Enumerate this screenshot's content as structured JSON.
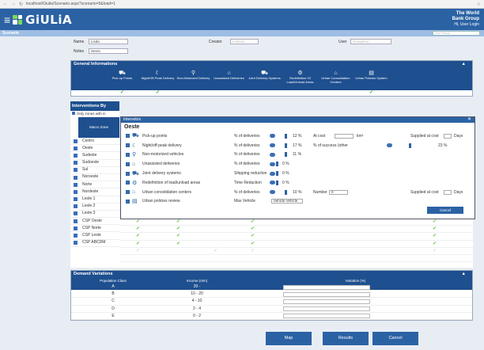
{
  "browser": {
    "url": "localhost/Giulia/Scenario.aspx?scenario=5&load=1"
  },
  "app": {
    "brand": "GiULiA",
    "org_line1": "The World",
    "org_line2": "Bank Group",
    "greeting": "Hi, User Login"
  },
  "breadcrumb": {
    "title": "Scenario",
    "search_placeholder": "Ola Pesca"
  },
  "form": {
    "name_label": "Name",
    "name_value": "Lisda",
    "creator_label": "Creator",
    "creator_value": "Instituto",
    "user_label": "User",
    "user_value": "Gsasphon",
    "notes_label": "Notes",
    "notes_value": "Seres"
  },
  "general": {
    "title": "General Informations",
    "columns": [
      "Pick-up Points",
      "Night/Off-Peak Delivery",
      "Non-Motorized Delivery",
      "Unassisted Deliveries",
      "Joint Delivery Systems",
      "Redefinition Of Load/Unload Areas",
      "Urban Consolidation Centers",
      "Urban Policies System"
    ]
  },
  "interventions": {
    "title": "Interventions By",
    "only_zones": "Only zones with in",
    "macro_zone": "Macro Zone",
    "zones": [
      "Centro",
      "Oeste",
      "Sudeste",
      "Sudoeste",
      "Sul",
      "Noroeste",
      "Norte",
      "Nordeste",
      "Leste 1",
      "Leste 2",
      "Leste 3",
      "CSP Oeste",
      "CSP Norte",
      "CSP Leste",
      "CSP ABCDM"
    ]
  },
  "modal": {
    "header": "Intervetos",
    "title": "Oeste",
    "cancel": "Cancel",
    "rows": [
      {
        "icon": "pickup-icon",
        "glyph": "⛟",
        "name": "Pick-up points",
        "label": "% of deliveries",
        "pct": "12 %",
        "extra": "At cost",
        "unit": "km²",
        "supplied": "Supplied at cost",
        "days": "Days"
      },
      {
        "icon": "moon-icon",
        "glyph": "☾",
        "name": "Night/off-peak delivery",
        "label": "% of deliveries",
        "pct": "17 %",
        "extra": "% of success (other",
        "pct2": "23 %"
      },
      {
        "icon": "bike-icon",
        "glyph": "⚲",
        "name": "Non-motorized vehicles",
        "label": "% of deliveries",
        "pct": "11 %"
      },
      {
        "icon": "home-icon",
        "glyph": "⌂",
        "name": "Unassisted deliveries",
        "label": "% of deliveries",
        "pct": "0 %"
      },
      {
        "icon": "truck-icon",
        "glyph": "⛟",
        "name": "Joint delivery systems",
        "label": "Shipping reduction",
        "pct": "0 %"
      },
      {
        "icon": "loading-icon",
        "glyph": "⚙",
        "name": "Redefinition of load/unload areas",
        "label": "Time Reduction",
        "pct": "0 %"
      },
      {
        "icon": "warehouse-icon",
        "glyph": "⌂",
        "name": "Urban consolidation centers",
        "label": "% of deliveries",
        "pct": "10 %",
        "extra": "Number",
        "num": "0",
        "supplied": "Supplied at cost",
        "days": "Days"
      },
      {
        "icon": "policy-icon",
        "glyph": "▤",
        "name": "Urban policies review",
        "label": "Max Vehicle",
        "select": "Vehicle Vehicle"
      }
    ]
  },
  "demand": {
    "title": "Demand Variations",
    "col1": "Population Class",
    "col2": "Income (min)",
    "col3": "Variation (%)",
    "rows": [
      {
        "cls": "A",
        "inc": "20 -"
      },
      {
        "cls": "B",
        "inc": "10 - 20"
      },
      {
        "cls": "C",
        "inc": "4 - 10"
      },
      {
        "cls": "D",
        "inc": "2 - 4"
      },
      {
        "cls": "E",
        "inc": "0 - 2"
      }
    ]
  },
  "buttons": {
    "map": "Map",
    "results": "Results",
    "cancel": "Cancel"
  },
  "colors": {
    "header": "#2b62a4",
    "panel": "#1e4f8f",
    "check": "#6cc24a"
  }
}
